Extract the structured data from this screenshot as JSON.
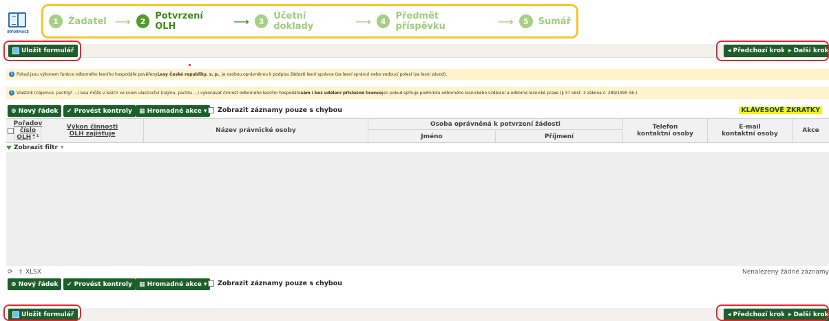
{
  "logo": {
    "label": "INFORMACE"
  },
  "wizard": {
    "steps": [
      {
        "num": "1",
        "label": "Žadatel"
      },
      {
        "num": "2",
        "label": "Potvrzení OLH"
      },
      {
        "num": "3",
        "label": "Účetní doklady"
      },
      {
        "num": "4",
        "label": "Předmět příspěvku"
      },
      {
        "num": "5",
        "label": "Sumář"
      }
    ],
    "arrow": "⟶"
  },
  "toolbar": {
    "save_label": "Uložit formulář",
    "prev_label": "◂ Předchozí krok",
    "next_label": "▸ Další krok"
  },
  "info": {
    "line1_pre": "Pokud jsou výkonem funkce odborného lesního hospodáře pověřeny ",
    "line1_bold": "Lesy České republiky, s. p.",
    "line1_post": ", je osobou oprávněnou k podpisu žádosti lesní správce (za lesní správu) nebo vedoucí polesí (za lesní závod).",
    "line2_pre": "Vlastník (nájemce, pachtýř ...) lesa může v lesích ve svém vlastnictví (nájmu, pachtu ...) vykonávat činnost odborného lesního hospodáře ",
    "line2_bold": "sám i bez udělení příslušné licence",
    "line2_post": " jen pokud splňuje podmínku odborného lesnického vzdělání a odborné lesnické praxe (§ 37 odst. 3 zákona č. 289/1995 Sb.)."
  },
  "grid_toolbar": {
    "new_row": "⊕ Nový řádek",
    "run_checks": "✔ Provést kontroly",
    "bulk_actions": "▦ Hromadné akce ▾",
    "only_errors": "Zobrazit záznamy pouze s chybou",
    "shortcuts": "KLÁVESOVÉ ZKRATKY"
  },
  "table": {
    "col_order": [
      "Pořadov",
      "číslo",
      "OLH"
    ],
    "col_order_sort": "⇡¹",
    "col_olh": [
      "Výkon činnosti",
      "OLH zajišťuje"
    ],
    "col_name": "Název právnické osoby",
    "col_person_group": "Osoba oprávněná k potvrzení žádosti",
    "col_first": "Jméno",
    "col_last": "Příjmení",
    "col_phone": [
      "Telefon",
      "kontaktní osoby"
    ],
    "col_email": [
      "E-mail",
      "kontaktní osoby"
    ],
    "col_actions": "Akce"
  },
  "filter": {
    "label": "Zobrazit filtr",
    "caret": "▾"
  },
  "footer": {
    "refresh": "⟳",
    "export": "⇪ XLSX",
    "no_records": "Nenalezeny žádné záznamy"
  },
  "colors": {
    "accent_green": "#1d5f2b",
    "highlight": "#f5c62b",
    "ring": "#e0262e"
  }
}
